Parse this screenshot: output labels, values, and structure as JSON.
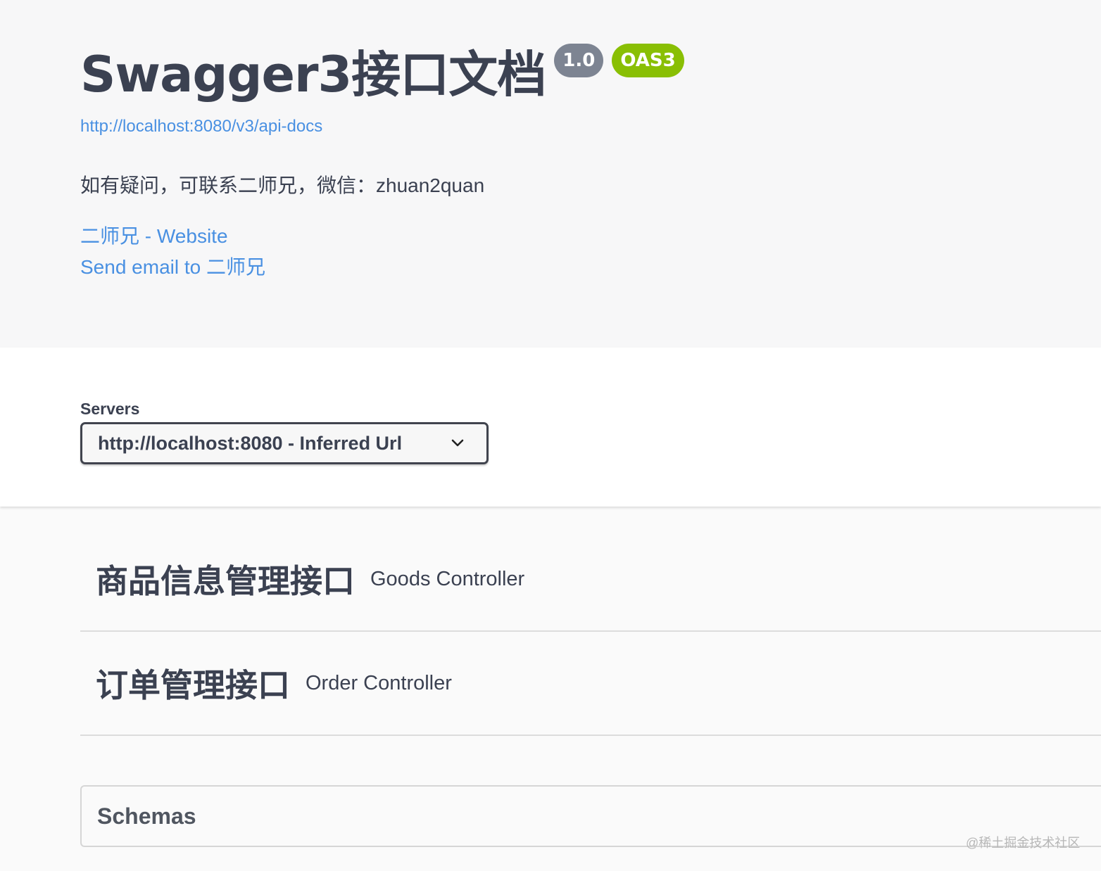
{
  "info": {
    "title": "Swagger3接口文档",
    "version_badge": "1.0",
    "oas_badge": "OAS3",
    "docs_url": "http://localhost:8080/v3/api-docs",
    "description": "如有疑问，可联系二师兄，微信：zhuan2quan",
    "contact_website": "二师兄 - Website",
    "contact_email": "Send email to 二师兄"
  },
  "servers": {
    "label": "Servers",
    "selected": "http://localhost:8080 - Inferred Url"
  },
  "tags": [
    {
      "name": "商品信息管理接口",
      "description": "Goods Controller"
    },
    {
      "name": "订单管理接口",
      "description": "Order Controller"
    }
  ],
  "schemas": {
    "title": "Schemas"
  },
  "watermark": "@稀土掘金技术社区",
  "colors": {
    "link": "#4990e2",
    "version_badge": "#7d8492",
    "oas_badge": "#89bf04",
    "text": "#3b4151"
  }
}
